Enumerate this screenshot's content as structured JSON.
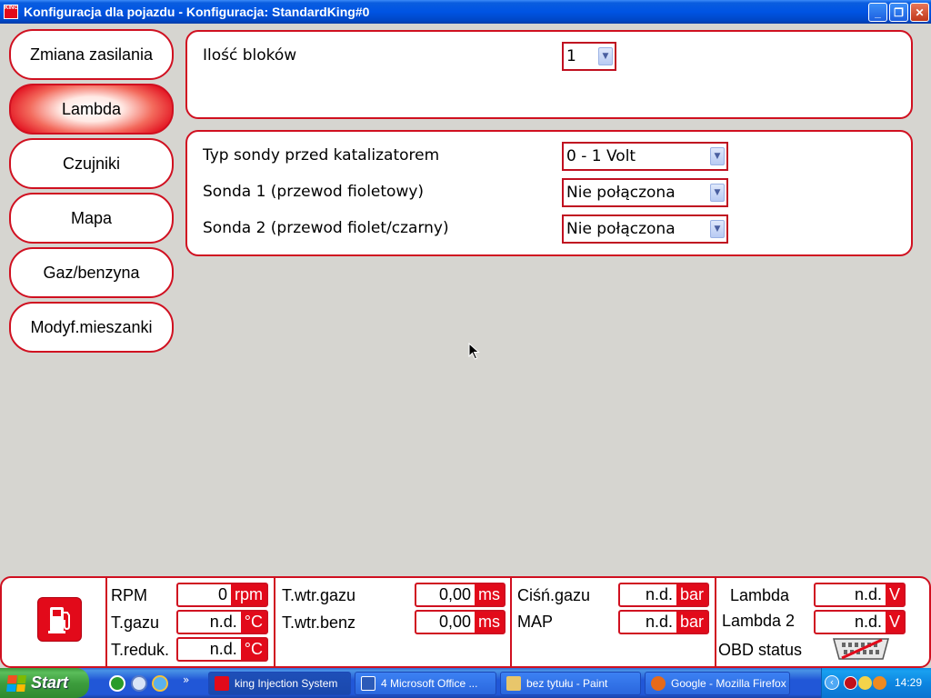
{
  "window": {
    "app_icon_text": "KING",
    "title": "Konfiguracja dla pojazdu - Konfiguracja: StandardKing#0",
    "controls": {
      "minimize": "_",
      "maximize": "❐",
      "close": "✕"
    }
  },
  "nav": {
    "items": [
      {
        "label": "Zmiana zasilania",
        "active": false
      },
      {
        "label": "Lambda",
        "active": true
      },
      {
        "label": "Czujniki",
        "active": false
      },
      {
        "label": "Mapa",
        "active": false
      },
      {
        "label": "Gaz/benzyna",
        "active": false
      },
      {
        "label": "Modyf.mieszanki",
        "active": false
      }
    ]
  },
  "blocks_panel": {
    "label": "Ilość bloków",
    "value": "1"
  },
  "probe_panel": {
    "rows": [
      {
        "label": "Typ sondy przed katalizatorem",
        "value": "0 - 1 Volt"
      },
      {
        "label": "Sonda 1 (przewod fioletowy)",
        "value": "Nie połączona"
      },
      {
        "label": "Sonda 2 (przewod fiolet/czarny)",
        "value": "Nie połączona"
      }
    ]
  },
  "status": {
    "rpm": {
      "label": "RPM",
      "value": "0",
      "unit": "rpm"
    },
    "t_gazu": {
      "label": "T.gazu",
      "value": "n.d.",
      "unit": "°C"
    },
    "t_reduk": {
      "label": "T.reduk.",
      "value": "n.d.",
      "unit": "°C"
    },
    "t_wtr_gazu": {
      "label": "T.wtr.gazu",
      "value": "0,00",
      "unit": "ms"
    },
    "t_wtr_benz": {
      "label": "T.wtr.benz",
      "value": "0,00",
      "unit": "ms"
    },
    "cisn_gazu": {
      "label": "Ciśń.gazu",
      "value": "n.d.",
      "unit": "bar"
    },
    "map": {
      "label": "MAP",
      "value": "n.d.",
      "unit": "bar"
    },
    "lambda": {
      "label": "Lambda",
      "value": "n.d.",
      "unit": "V"
    },
    "lambda2": {
      "label": "Lambda 2",
      "value": "n.d.",
      "unit": "V"
    },
    "obd": {
      "label": "OBD status"
    }
  },
  "taskbar": {
    "start_label": "Start",
    "quick_launch_more": "»",
    "items": [
      {
        "label": "king Injection System",
        "active": true
      },
      {
        "label": "4 Microsoft Office ...",
        "active": false
      },
      {
        "label": "bez tytułu - Paint",
        "active": false
      },
      {
        "label": "Google - Mozilla Firefox",
        "active": false
      }
    ],
    "tray_collapse": "‹",
    "clock": "14:29"
  },
  "colors": {
    "accent_red": "#d01020",
    "fill_red": "#e20a1a",
    "xp_blue": "#0054e3",
    "background": "#d6d5d0"
  }
}
